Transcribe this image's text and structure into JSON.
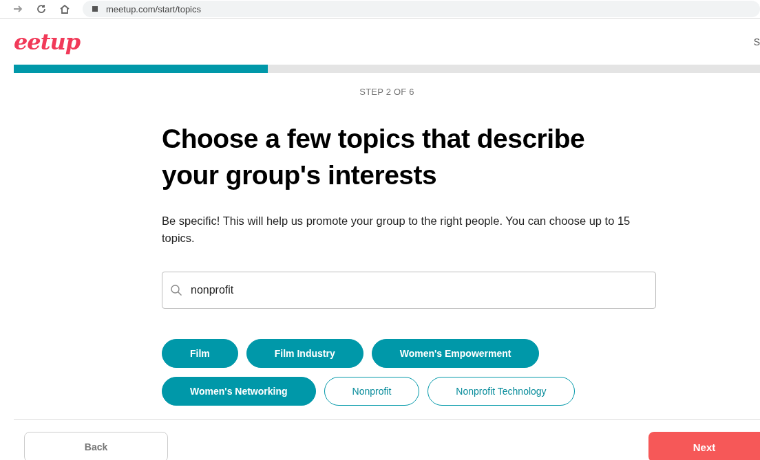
{
  "browser": {
    "url": "meetup.com/start/topics"
  },
  "header": {
    "logo": "eetup",
    "right_link": "S"
  },
  "progress": {
    "level": 0.34
  },
  "step": "STEP 2 OF 6",
  "title": "Choose a few topics that describe your group's interests",
  "description": "Be specific! This will help us promote your group to the right people. You can choose up to 15 topics.",
  "search": {
    "value": "nonprofit"
  },
  "topics": [
    {
      "label": "Film",
      "selected": true
    },
    {
      "label": "Film Industry",
      "selected": true
    },
    {
      "label": "Women's Empowerment",
      "selected": true
    },
    {
      "label": "Women's Networking",
      "selected": true
    },
    {
      "label": "Nonprofit",
      "selected": false
    },
    {
      "label": "Nonprofit Technology",
      "selected": false
    }
  ],
  "footer": {
    "back": "Back",
    "next": "Next"
  }
}
